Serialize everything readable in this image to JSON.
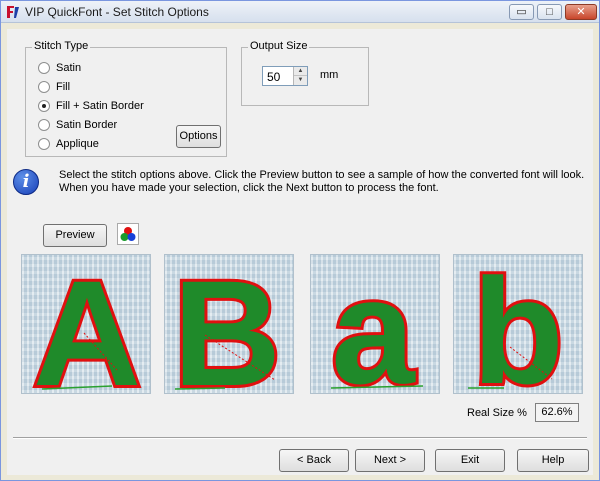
{
  "window": {
    "title": "VIP QuickFont - Set Stitch Options",
    "controls": {
      "minimize": "▭",
      "maximize": "□",
      "close": "✕"
    }
  },
  "stitch_type": {
    "legend": "Stitch Type",
    "options": [
      "Satin",
      "Fill",
      "Fill + Satin Border",
      "Satin Border",
      "Applique"
    ],
    "selected": "Fill + Satin Border",
    "options_button": "Options"
  },
  "output_size": {
    "legend": "Output Size",
    "value": "50",
    "unit": "mm"
  },
  "info": {
    "icon": "i",
    "text": "Select the stitch options above. Click the Preview button to see a sample of how the converted font will look. When you have made your selection, click the Next button to process the font."
  },
  "preview": {
    "button": "Preview",
    "letters": [
      "A",
      "B",
      "a",
      "b"
    ],
    "colors": {
      "fill": "#1f8a2a",
      "border": "#e01010"
    }
  },
  "real_size": {
    "label": "Real Size %",
    "value": "62.6%"
  },
  "nav": {
    "back": "< Back",
    "next": "Next >",
    "exit": "Exit",
    "help": "Help"
  }
}
